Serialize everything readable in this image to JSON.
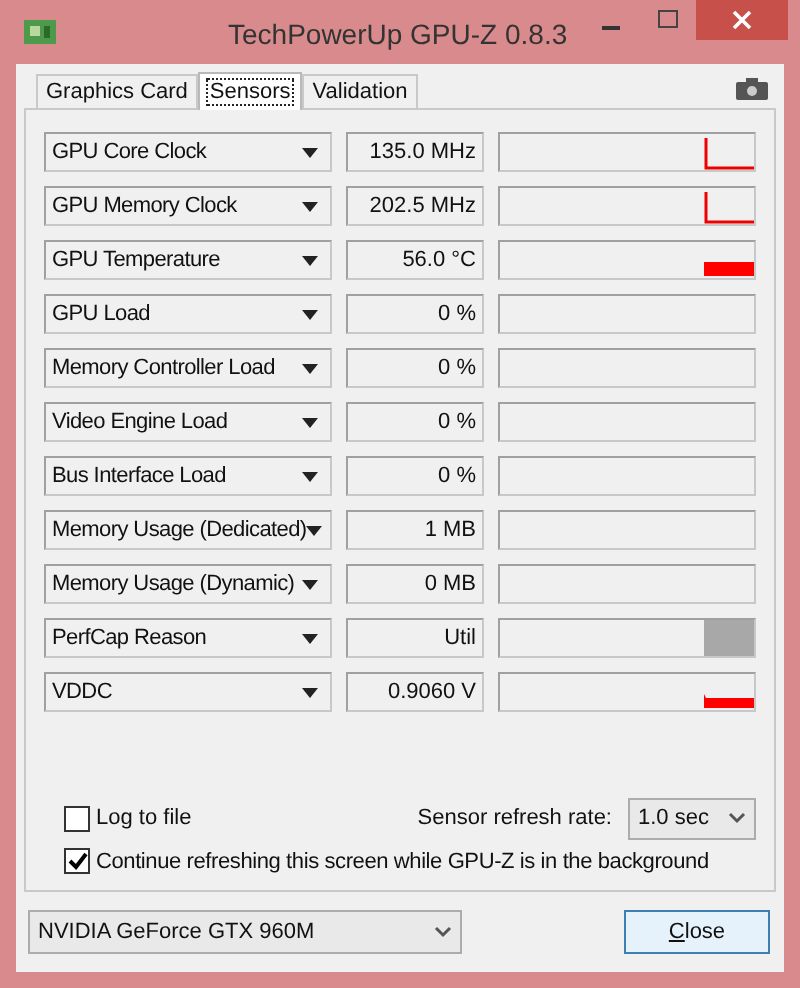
{
  "window": {
    "title": "TechPowerUp GPU-Z 0.8.3"
  },
  "tabs": [
    {
      "label": "Graphics Card",
      "selected": false
    },
    {
      "label": "Sensors",
      "selected": true
    },
    {
      "label": "Validation",
      "selected": false
    }
  ],
  "sensors": [
    {
      "name": "GPU Core Clock",
      "value": "135.0 MHz",
      "kind": "spike"
    },
    {
      "name": "GPU Memory Clock",
      "value": "202.5 MHz",
      "kind": "spike"
    },
    {
      "name": "GPU Temperature",
      "value": "56.0 °C",
      "kind": "bar"
    },
    {
      "name": "GPU Load",
      "value": "0 %",
      "kind": "flat"
    },
    {
      "name": "Memory Controller Load",
      "value": "0 %",
      "kind": "flat"
    },
    {
      "name": "Video Engine Load",
      "value": "0 %",
      "kind": "flat"
    },
    {
      "name": "Bus Interface Load",
      "value": "0 %",
      "kind": "flat"
    },
    {
      "name": "Memory Usage (Dedicated)",
      "value": "1 MB",
      "kind": "flat"
    },
    {
      "name": "Memory Usage (Dynamic)",
      "value": "0 MB",
      "kind": "flat"
    },
    {
      "name": "PerfCap Reason",
      "value": "Util",
      "kind": "block"
    },
    {
      "name": "VDDC",
      "value": "0.9060 V",
      "kind": "step"
    }
  ],
  "log_to_file": {
    "label": "Log to file",
    "checked": false
  },
  "refresh_rate": {
    "label": "Sensor refresh rate:",
    "value": "1.0 sec"
  },
  "continue_refreshing": {
    "label": "Continue refreshing this screen while GPU-Z is in the background",
    "checked": true
  },
  "gpu_select": {
    "value": "NVIDIA GeForce GTX 960M"
  },
  "close_button": "Close"
}
